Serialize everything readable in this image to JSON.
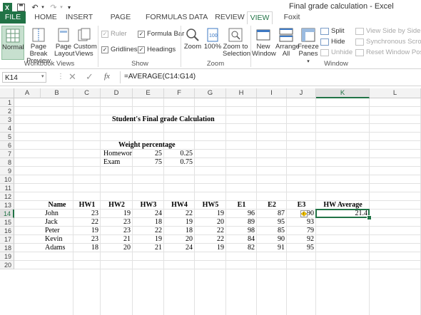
{
  "window": {
    "title": "Final grade calculation - Excel"
  },
  "tabs": [
    "FILE",
    "HOME",
    "INSERT",
    "PAGE LAYOUT",
    "FORMULAS",
    "DATA",
    "REVIEW",
    "VIEW",
    "Foxit PDF"
  ],
  "active_tab": "VIEW",
  "ribbon": {
    "workbook_views": {
      "label": "Workbook Views",
      "normal": "Normal",
      "page_break_1": "Page Break",
      "page_break_2": "Preview",
      "page_layout_1": "Page",
      "page_layout_2": "Layout",
      "custom_views_1": "Custom",
      "custom_views_2": "Views"
    },
    "show": {
      "label": "Show",
      "ruler": "Ruler",
      "formula_bar": "Formula Bar",
      "gridlines": "Gridlines",
      "headings": "Headings"
    },
    "zoom": {
      "label": "Zoom",
      "zoom": "Zoom",
      "hundred": "100%",
      "zoom_sel_1": "Zoom to",
      "zoom_sel_2": "Selection"
    },
    "window": {
      "label": "Window",
      "new_window_1": "New",
      "new_window_2": "Window",
      "arrange_1": "Arrange",
      "arrange_2": "All",
      "freeze_1": "Freeze",
      "freeze_2": "Panes",
      "split": "Split",
      "hide": "Hide",
      "unhide": "Unhide",
      "side_by_side": "View Side by Side",
      "sync_scroll": "Synchronous Scrolling",
      "reset_pos": "Reset Window Position"
    }
  },
  "formula_bar": {
    "name_box": "K14",
    "formula": "=AVERAGE(C14:G14)"
  },
  "columns": [
    "A",
    "B",
    "C",
    "D",
    "E",
    "F",
    "G",
    "H",
    "I",
    "J",
    "K",
    "L"
  ],
  "rows": [
    "1",
    "2",
    "3",
    "4",
    "5",
    "6",
    "7",
    "8",
    "9",
    "10",
    "11",
    "12",
    "13",
    "14",
    "15",
    "16",
    "17",
    "18",
    "19",
    "20"
  ],
  "selected_cell": "K14",
  "sheet": {
    "title": "Student's Final grade Calculation",
    "weight_header": "Weight percentage",
    "weights": [
      {
        "label": "Homewor",
        "value": "25",
        "ratio": "0.25"
      },
      {
        "label": "Exam",
        "value": "75",
        "ratio": "0.75"
      }
    ],
    "headers": [
      "Name",
      "HW1",
      "HW2",
      "HW3",
      "HW4",
      "HW5",
      "E1",
      "E2",
      "E3",
      "HW Average"
    ],
    "students": [
      {
        "name": "John",
        "scores": [
          "23",
          "19",
          "24",
          "22",
          "19",
          "96",
          "87",
          "90"
        ],
        "avg": "21.4"
      },
      {
        "name": "Jack",
        "scores": [
          "22",
          "23",
          "18",
          "19",
          "20",
          "89",
          "95",
          "93"
        ],
        "avg": ""
      },
      {
        "name": "Peter",
        "scores": [
          "19",
          "23",
          "22",
          "18",
          "22",
          "98",
          "85",
          "79"
        ],
        "avg": ""
      },
      {
        "name": "Kevin",
        "scores": [
          "23",
          "21",
          "19",
          "20",
          "22",
          "84",
          "90",
          "92"
        ],
        "avg": ""
      },
      {
        "name": "Adams",
        "scores": [
          "18",
          "20",
          "21",
          "24",
          "19",
          "82",
          "91",
          "95"
        ],
        "avg": ""
      }
    ]
  },
  "colors": {
    "accent": "#217346",
    "selected_button": "#c7e0cf"
  }
}
